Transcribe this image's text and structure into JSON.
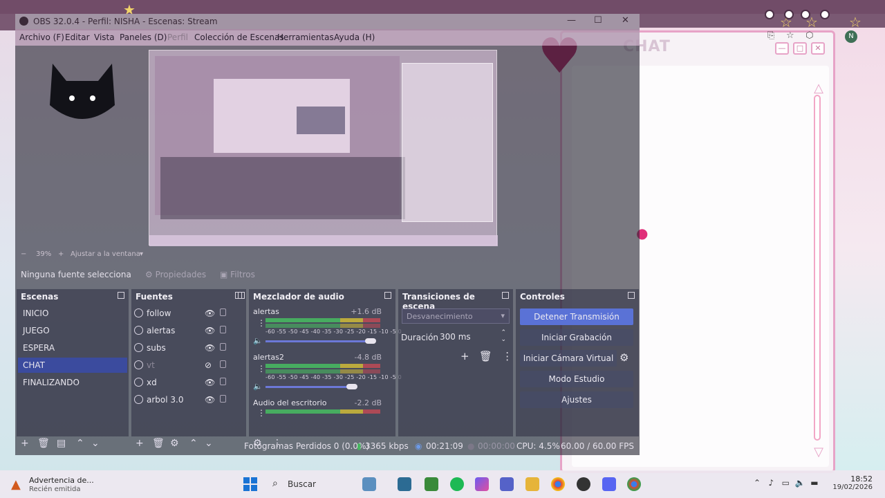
{
  "obs": {
    "title": "OBS 32.0.4 - Perfil: NISHA - Escenas: Stream",
    "menu": [
      "Archivo (F)",
      "Editar",
      "Vista",
      "Paneles (D)",
      "Perfil",
      "Colección de Escenas",
      "Herramientas",
      "Ayuda (H)"
    ],
    "zoom": {
      "minus": "−",
      "value": "39%",
      "plus": "+",
      "fit": "Ajustar a la ventana"
    },
    "source_bar": {
      "no_selection": "Ninguna fuente selecciona",
      "properties": "Propiedades",
      "filters": "Filtros"
    },
    "scenes": {
      "title": "Escenas",
      "items": [
        "INICIO",
        "JUEGO",
        "ESPERA",
        "CHAT",
        "FINALIZANDO"
      ],
      "selected": "CHAT"
    },
    "sources": {
      "title": "Fuentes",
      "items": [
        "follow",
        "alertas",
        "subs",
        "vt",
        "xd",
        "arbol 3.0"
      ]
    },
    "mixer": {
      "title": "Mezclador de audio",
      "scale": "-60 -55 -50 -45 -40 -35 -30 -25 -20 -15 -10 -5 0",
      "channels": [
        {
          "name": "alertas",
          "db": "+1.6 dB",
          "volume": 0.95
        },
        {
          "name": "alertas2",
          "db": "-4.8 dB",
          "volume": 0.78
        },
        {
          "name": "Audio del escritorio",
          "db": "-2.2 dB"
        }
      ]
    },
    "transitions": {
      "title": "Transiciones de escena",
      "selected": "Desvanecimiento",
      "duration_label": "Duración",
      "duration_value": "300 ms"
    },
    "controls": {
      "title": "Controles",
      "buttons": [
        "Detener Transmisión",
        "Iniciar Grabación",
        "Iniciar Cámara Virtual",
        "Modo Estudio",
        "Ajustes"
      ]
    },
    "status": {
      "dropped": "Fotogramas Perdidos 0 (0.0%)",
      "bitrate": "3365 kbps",
      "stream_time": "00:21:09",
      "rec_time": "00:00:00",
      "cpu": "CPU: 4.5%",
      "fps": "60.00 / 60.00 FPS"
    }
  },
  "chat_window": {
    "title": "CHAT"
  },
  "taskbar": {
    "notification_title": "Advertencia de...",
    "notification_sub": "Recién emitida",
    "search": "Buscar",
    "time": "18:52",
    "date": "19/02/2026"
  },
  "browser": {
    "avatar": "N"
  },
  "colors": {
    "accent": "#5a72d6",
    "selected_scene": "#3b4b9e",
    "meter_green": "#47b760",
    "heart": "#b0185a"
  }
}
